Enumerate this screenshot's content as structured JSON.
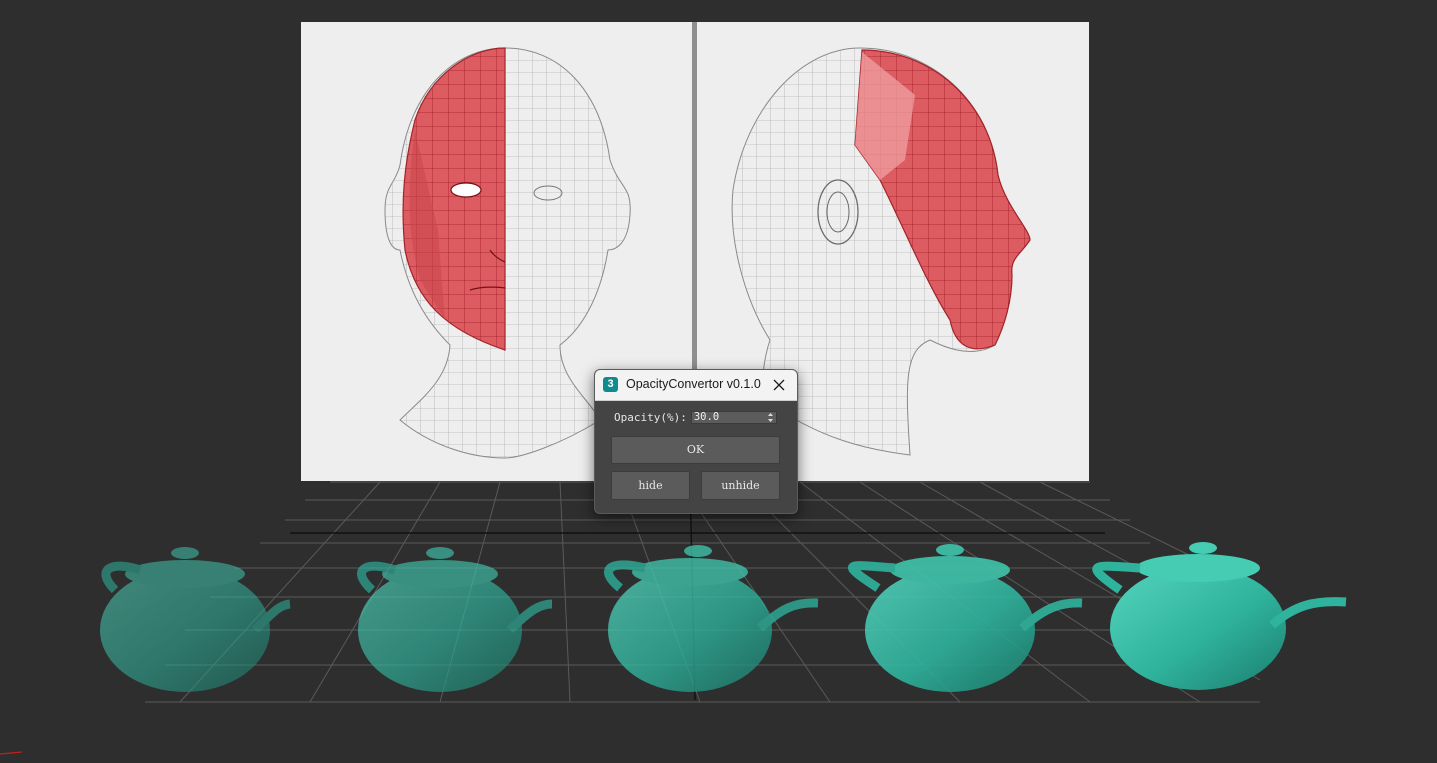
{
  "dialog": {
    "title": "OpacityConvertor v0.1.0",
    "app_icon_text": "3",
    "opacity_label": "Opacity(%):",
    "opacity_value": "30.0",
    "ok_label": "OK",
    "hide_label": "hide",
    "unhide_label": "unhide"
  },
  "scene": {
    "background_color": "#2e2e2e",
    "reference_plane_color": "#eeeeee",
    "mesh_highlight_color": "#d9464c",
    "teapot_color": "#2fb39d",
    "grid_color": "#5a5a5a"
  }
}
